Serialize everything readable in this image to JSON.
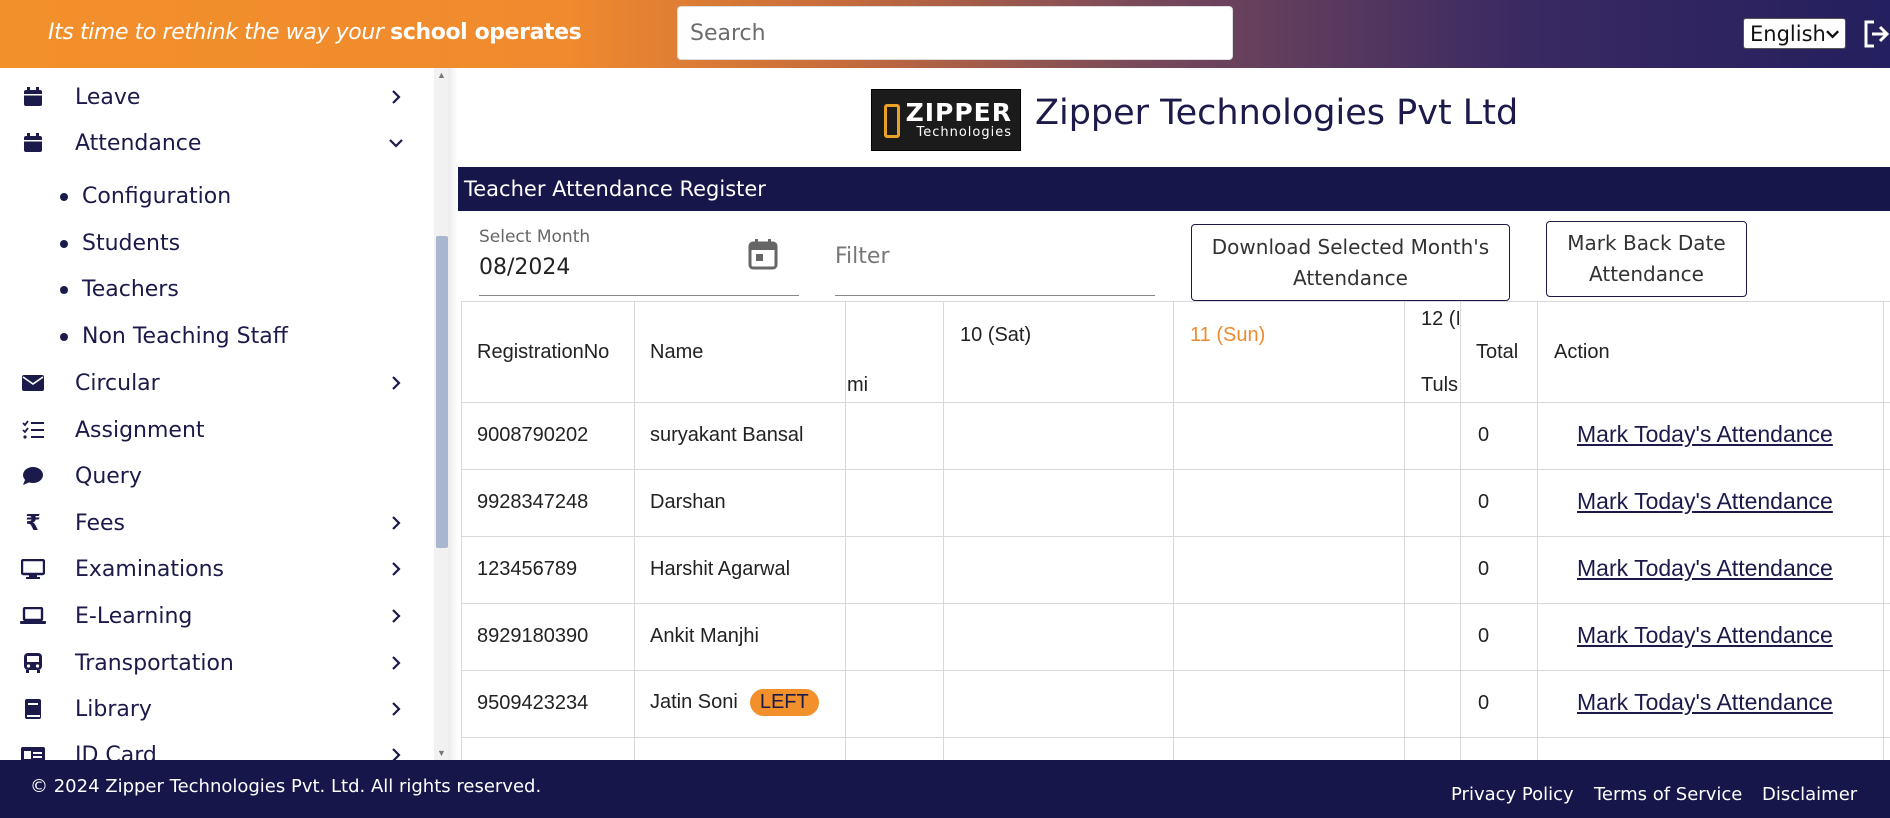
{
  "header": {
    "tagline_prefix": "Its time to rethink the way your ",
    "tagline_bold": "school operates",
    "search_placeholder": "Search",
    "language": "English",
    "logout_icon": "logout-icon"
  },
  "sidebar": {
    "items": [
      {
        "label": "Leave",
        "icon": "calendar-icon",
        "chevron": "right"
      },
      {
        "label": "Attendance",
        "icon": "calendar-icon",
        "chevron": "down"
      },
      {
        "label": "Circular",
        "icon": "envelope-icon",
        "chevron": "right"
      },
      {
        "label": "Assignment",
        "icon": "checklist-icon",
        "chevron": ""
      },
      {
        "label": "Query",
        "icon": "chat-icon",
        "chevron": ""
      },
      {
        "label": "Fees",
        "icon": "rupee-icon",
        "chevron": "right"
      },
      {
        "label": "Examinations",
        "icon": "desktop-icon",
        "chevron": "right"
      },
      {
        "label": "E-Learning",
        "icon": "laptop-icon",
        "chevron": "right"
      },
      {
        "label": "Transportation",
        "icon": "bus-icon",
        "chevron": "right"
      },
      {
        "label": "Library",
        "icon": "book-icon",
        "chevron": "right"
      },
      {
        "label": "ID Card",
        "icon": "id-card-icon",
        "chevron": "right"
      }
    ],
    "attendance_sub": [
      "Configuration",
      "Students",
      "Teachers",
      "Non Teaching Staff"
    ]
  },
  "brand": {
    "logo_text": "ZIPPER",
    "logo_sub": "Technologies",
    "name": "Zipper Technologies Pvt Ltd"
  },
  "register": {
    "title": "Teacher Attendance Register",
    "month_label": "Select Month",
    "month_value": "08/2024",
    "filter_placeholder": "Filter",
    "download_btn": "Download Selected Month's Attendance",
    "mark_back_btn": "Mark Back Date Attendance"
  },
  "table": {
    "headers": {
      "reg": "RegistrationNo",
      "name": "Name",
      "partial_col": "mi",
      "d10": "10 (Sat)",
      "d11": "11 (Sun)",
      "d12": "12 (I",
      "d12_sub": "Tuls",
      "total": "Total",
      "action": "Action"
    },
    "rows": [
      {
        "reg": "9008790202",
        "name": "suryakant Bansal",
        "badge": "",
        "total": "0",
        "action": "Mark Today's Attendance"
      },
      {
        "reg": "9928347248",
        "name": "Darshan",
        "badge": "",
        "total": "0",
        "action": "Mark Today's Attendance"
      },
      {
        "reg": "123456789",
        "name": "Harshit Agarwal",
        "badge": "",
        "total": "0",
        "action": "Mark Today's Attendance"
      },
      {
        "reg": "8929180390",
        "name": "Ankit Manjhi",
        "badge": "",
        "total": "0",
        "action": "Mark Today's Attendance"
      },
      {
        "reg": "9509423234",
        "name": "Jatin Soni",
        "badge": "LEFT",
        "total": "0",
        "action": "Mark Today's Attendance"
      }
    ]
  },
  "footer": {
    "copyright": "© 2024 Zipper Technologies Pvt. Ltd. All rights reserved.",
    "links": [
      "Privacy Policy",
      "Terms of Service",
      "Disclaimer"
    ]
  },
  "colors": {
    "navy": "#16164a",
    "orange": "#f2902b",
    "sunday": "#f08a2e"
  }
}
